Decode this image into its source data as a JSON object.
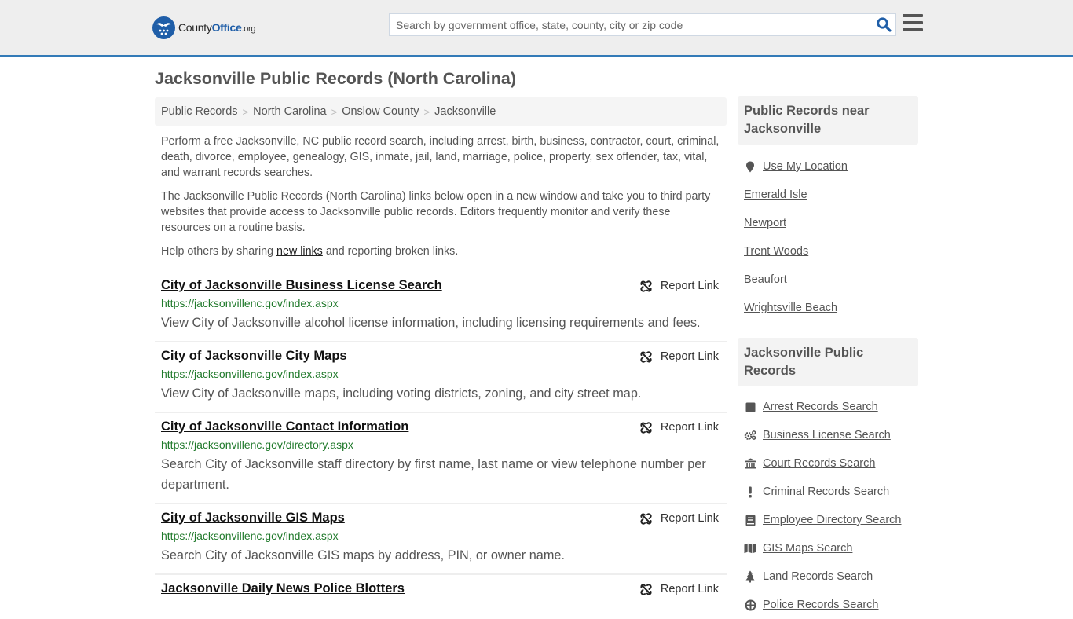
{
  "header": {
    "logo": {
      "county": "County",
      "office": "Office",
      "org": ".org",
      "icon": "eagle-stars-badge"
    },
    "search": {
      "placeholder": "Search by government office, state, county, city or zip code",
      "value": "",
      "icon": "search-icon"
    },
    "menu_icon": "hamburger-menu-icon",
    "accent_color": "#337ab7"
  },
  "page": {
    "title": "Jacksonville Public Records (North Carolina)"
  },
  "breadcrumb": [
    {
      "label": "Public Records"
    },
    {
      "label": "North Carolina"
    },
    {
      "label": "Onslow County"
    },
    {
      "label": "Jacksonville"
    }
  ],
  "breadcrumb_separator": ">",
  "intro": {
    "p1": "Perform a free Jacksonville, NC public record search, including arrest, birth, business, contractor, court, criminal, death, divorce, employee, genealogy, GIS, inmate, jail, land, marriage, police, property, sex offender, tax, vital, and warrant records searches.",
    "p2": "The Jacksonville Public Records (North Carolina) links below open in a new window and take you to third party websites that provide access to Jacksonville public records. Editors frequently monitor and verify these resources on a routine basis.",
    "p3_before": "Help others by sharing ",
    "p3_link": "new links",
    "p3_after": " and reporting broken links."
  },
  "report_label": "Report Link",
  "records": [
    {
      "title": "City of Jacksonville Business License Search",
      "url": "https://jacksonvillenc.gov/index.aspx",
      "description": "View City of Jacksonville alcohol license information, including licensing requirements and fees."
    },
    {
      "title": "City of Jacksonville City Maps",
      "url": "https://jacksonvillenc.gov/index.aspx",
      "description": "View City of Jacksonville maps, including voting districts, zoning, and city street map."
    },
    {
      "title": "City of Jacksonville Contact Information",
      "url": "https://jacksonvillenc.gov/directory.aspx",
      "description": "Search City of Jacksonville staff directory by first name, last name or view telephone number per department."
    },
    {
      "title": "City of Jacksonville GIS Maps",
      "url": "https://jacksonvillenc.gov/index.aspx",
      "description": "Search City of Jacksonville GIS maps by address, PIN, or owner name."
    },
    {
      "title": "Jacksonville Daily News Police Blotters",
      "url": "",
      "description": ""
    }
  ],
  "sidebar": {
    "nearby_title": "Public Records near Jacksonville",
    "use_location": "Use My Location",
    "nearby": [
      {
        "label": "Emerald Isle"
      },
      {
        "label": "Newport"
      },
      {
        "label": "Trent Woods"
      },
      {
        "label": "Beaufort"
      },
      {
        "label": "Wrightsville Beach"
      }
    ],
    "categories_title": "Jacksonville Public Records",
    "categories": [
      {
        "label": "Arrest Records Search",
        "icon": "square-icon"
      },
      {
        "label": "Business License Search",
        "icon": "gears-icon"
      },
      {
        "label": "Court Records Search",
        "icon": "courthouse-icon"
      },
      {
        "label": "Criminal Records Search",
        "icon": "exclamation-icon"
      },
      {
        "label": "Employee Directory Search",
        "icon": "book-icon"
      },
      {
        "label": "GIS Maps Search",
        "icon": "map-icon"
      },
      {
        "label": "Land Records Search",
        "icon": "tree-icon"
      },
      {
        "label": "Police Records Search",
        "icon": "police-icon"
      }
    ]
  }
}
